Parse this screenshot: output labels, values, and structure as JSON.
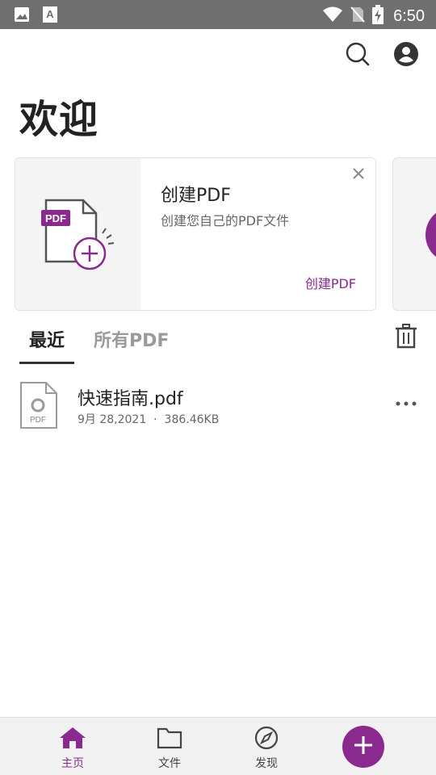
{
  "status_bar": {
    "time": "6:50",
    "icons": [
      "image-icon",
      "font-icon",
      "wifi-icon",
      "no-sim-icon",
      "battery-charging-icon"
    ]
  },
  "header": {
    "title": "欢迎",
    "actions": [
      "search-icon",
      "account-icon"
    ]
  },
  "card": {
    "title": "创建PDF",
    "description": "创建您自己的PDF文件",
    "link": "创建PDF",
    "badge": "PDF"
  },
  "tabs": [
    {
      "label": "最近",
      "active": true
    },
    {
      "label": "所有PDF",
      "active": false
    }
  ],
  "files": [
    {
      "name": "快速指南.pdf",
      "date": "9月 28,2021",
      "separator": "·",
      "size": "386.46KB",
      "icon_label": "PDF"
    }
  ],
  "bottom_nav": {
    "items": [
      {
        "label": "主页",
        "icon": "home-icon",
        "active": true
      },
      {
        "label": "文件",
        "icon": "folder-icon",
        "active": false
      },
      {
        "label": "发现",
        "icon": "compass-icon",
        "active": false
      }
    ],
    "fab_icon": "plus-icon"
  },
  "colors": {
    "accent": "#8a2a8f",
    "status_bar": "#6f6f6f",
    "nav_background": "#f1f1f1"
  }
}
